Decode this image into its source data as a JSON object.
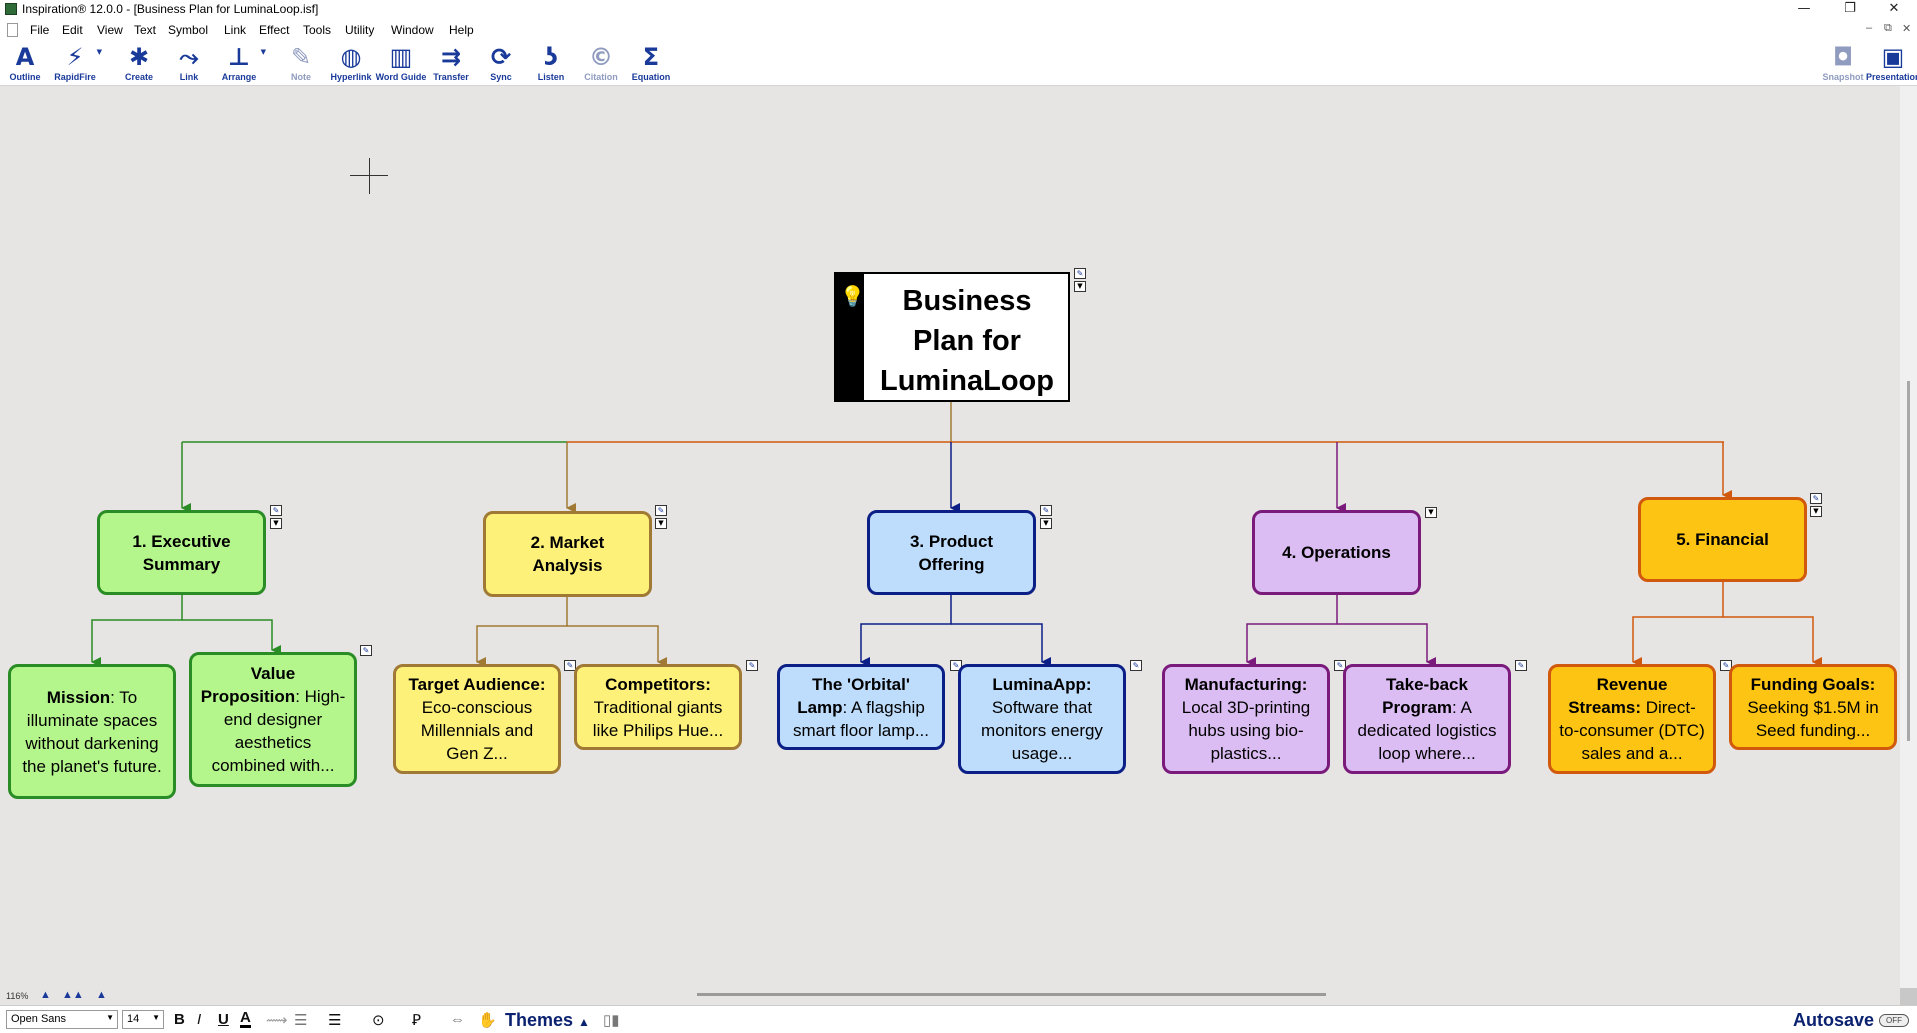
{
  "window": {
    "title": "Inspiration® 12.0.0 - [Business Plan for LuminaLoop.isf]",
    "controls": {
      "minimize": "—",
      "maximize": "❐",
      "close": "✕"
    }
  },
  "menubar": {
    "items": [
      "File",
      "Edit",
      "View",
      "Text",
      "Symbol",
      "Link",
      "Effect",
      "Tools",
      "Utility",
      "Window",
      "Help"
    ],
    "mdi_controls": [
      "–",
      "⧉",
      "✕"
    ]
  },
  "toolbar": {
    "buttons": [
      {
        "label": "Outline",
        "icon": "outline-icon",
        "glyph": "A"
      },
      {
        "label": "RapidFire",
        "icon": "rapidfire-icon",
        "glyph": "⚡"
      },
      {
        "label": "Create",
        "icon": "create-icon",
        "glyph": "✱"
      },
      {
        "label": "Link",
        "icon": "link-icon",
        "glyph": "⤳"
      },
      {
        "label": "Arrange",
        "icon": "arrange-icon",
        "glyph": "⊥"
      },
      {
        "label": "Note",
        "icon": "note-icon",
        "glyph": "✎"
      },
      {
        "label": "Hyperlink",
        "icon": "globe-icon",
        "glyph": "◍"
      },
      {
        "label": "Word Guide",
        "icon": "word-guide-icon",
        "glyph": "▥"
      },
      {
        "label": "Transfer",
        "icon": "transfer-icon",
        "glyph": "⇉"
      },
      {
        "label": "Sync",
        "icon": "sync-icon",
        "glyph": "⟳"
      },
      {
        "label": "Listen",
        "icon": "listen-icon",
        "glyph": "ʖ"
      },
      {
        "label": "Citation",
        "icon": "citation-icon",
        "glyph": "©"
      },
      {
        "label": "Equation",
        "icon": "sigma-icon",
        "glyph": "Σ"
      },
      {
        "label": "Snapshot",
        "icon": "camera-icon",
        "glyph": "◘"
      },
      {
        "label": "Presentation",
        "icon": "presentation-icon",
        "glyph": "▣"
      }
    ]
  },
  "diagram": {
    "main_idea": "Business Plan for LuminaLoop",
    "main_idea_lines": [
      "Business",
      "Plan for",
      "LuminaLoop"
    ],
    "topics": [
      {
        "label_lines": [
          "1. Executive",
          "Summary"
        ],
        "color": "#b4f58c"
      },
      {
        "label_lines": [
          "2. Market",
          "Analysis"
        ],
        "color": "#fef17a"
      },
      {
        "label_lines": [
          "3. Product",
          "Offering"
        ],
        "color": "#bedcfb"
      },
      {
        "label_lines": [
          "4. Operations"
        ],
        "color": "#dcbdf3"
      },
      {
        "label_lines": [
          "5. Financial"
        ],
        "color": "#fdc414"
      }
    ],
    "subtopics": [
      {
        "head": "Mission",
        "body": ": To illuminate spaces without darkening the planet's future."
      },
      {
        "head": "Value Proposition",
        "body": ": High-end designer aesthetics combined with..."
      },
      {
        "head": "Target Audience:",
        "body": " Eco-conscious Millennials and Gen Z..."
      },
      {
        "head": "Competitors:",
        "body": " Traditional giants like Philips Hue..."
      },
      {
        "head": "The 'Orbital' Lamp",
        "body": ": A flagship smart floor lamp..."
      },
      {
        "head": "LuminaApp:",
        "body": " Software that monitors energy usage..."
      },
      {
        "head": "Manufacturing:",
        "body": " Local 3D-printing hubs using bio-plastics..."
      },
      {
        "head": "Take-back Program",
        "body": ": A dedicated logistics loop where..."
      },
      {
        "head": "Revenue Streams:",
        "body": " Direct-to-consumer (DTC) sales and a..."
      },
      {
        "head": "Funding Goals:",
        "body": " Seeking $1.5M in Seed funding..."
      }
    ]
  },
  "status": {
    "zoom": "116%"
  },
  "formatbar": {
    "font": "Open Sans",
    "size": "14",
    "bold": "B",
    "italic": "I",
    "underline": "U",
    "color": "A",
    "themes": "Themes",
    "autosave": "Autosave",
    "autosave_state": "OFF"
  },
  "colors": {
    "green_border": "#2a8c24",
    "yellow_border": "#a07a35",
    "blue_border": "#0b1f86",
    "purple_border": "#7a1b7c",
    "orange_border": "#d1590d",
    "toolbar_blue": "#1a3a9a"
  }
}
